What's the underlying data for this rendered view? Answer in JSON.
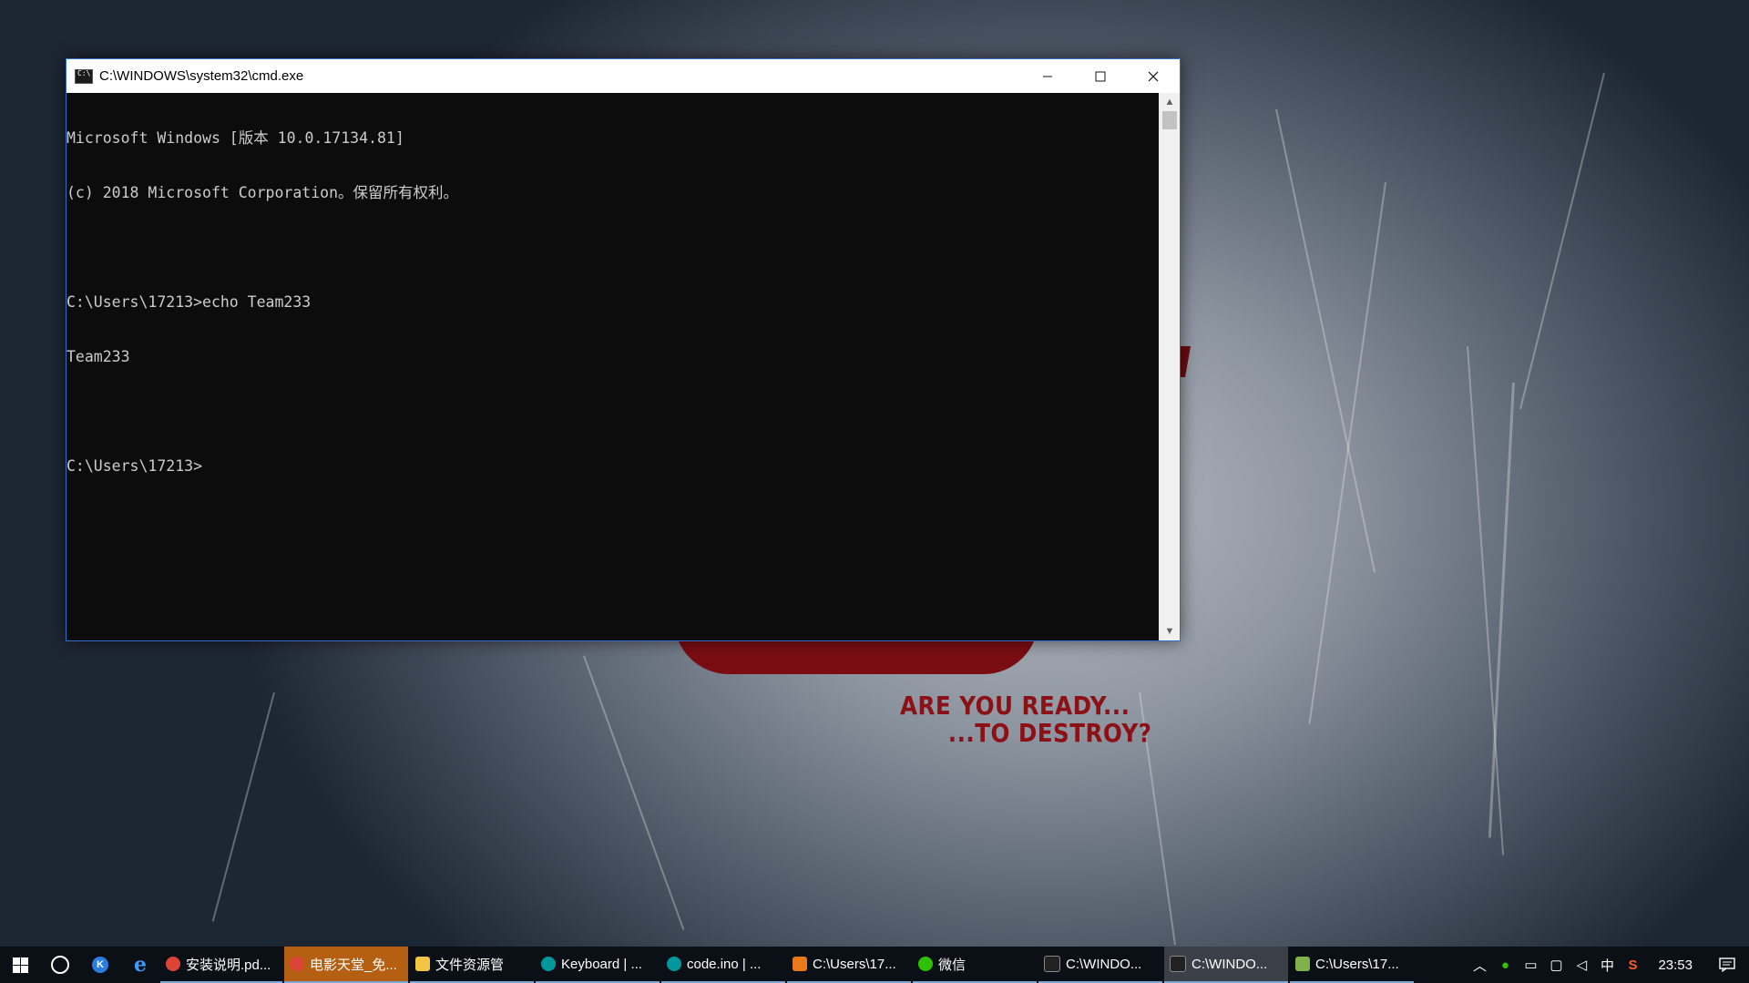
{
  "wallpaper": {
    "tagline_1": "ARE YOU READY...",
    "tagline_2": "...TO DESTROY?"
  },
  "window": {
    "title": "C:\\WINDOWS\\system32\\cmd.exe",
    "minimize_icon": "minimize-icon",
    "maximize_icon": "maximize-icon",
    "close_icon": "close-icon",
    "console_lines": [
      "Microsoft Windows [版本 10.0.17134.81]",
      "(c) 2018 Microsoft Corporation。保留所有权利。",
      "",
      "C:\\Users\\17213>echo Team233",
      "Team233",
      "",
      "C:\\Users\\17213>"
    ]
  },
  "taskbar": {
    "apps": [
      {
        "label": "安装说明.pd...",
        "icon": "chrome-icon",
        "color": "#db4437"
      },
      {
        "label": "电影天堂_免...",
        "icon": "chrome-icon",
        "color": "#db4437"
      },
      {
        "label": "文件资源管",
        "icon": "folder-icon",
        "color": "#f3c545"
      },
      {
        "label": "Keyboard | ...",
        "icon": "arduino-icon",
        "color": "#00979d"
      },
      {
        "label": "code.ino | ...",
        "icon": "arduino-icon",
        "color": "#00979d"
      },
      {
        "label": "C:\\Users\\17...",
        "icon": "sublime-icon",
        "color": "#e87a1c"
      },
      {
        "label": "微信",
        "icon": "wechat-icon",
        "color": "#2dc100"
      },
      {
        "label": "C:\\WINDO...",
        "icon": "cmd-icon",
        "color": "#222222"
      },
      {
        "label": "C:\\WINDO...",
        "icon": "cmd-icon",
        "color": "#222222"
      },
      {
        "label": "C:\\Users\\17...",
        "icon": "notepad-icon",
        "color": "#7fb34a"
      }
    ],
    "tray": {
      "ime": "中",
      "clock": "23:53"
    }
  }
}
